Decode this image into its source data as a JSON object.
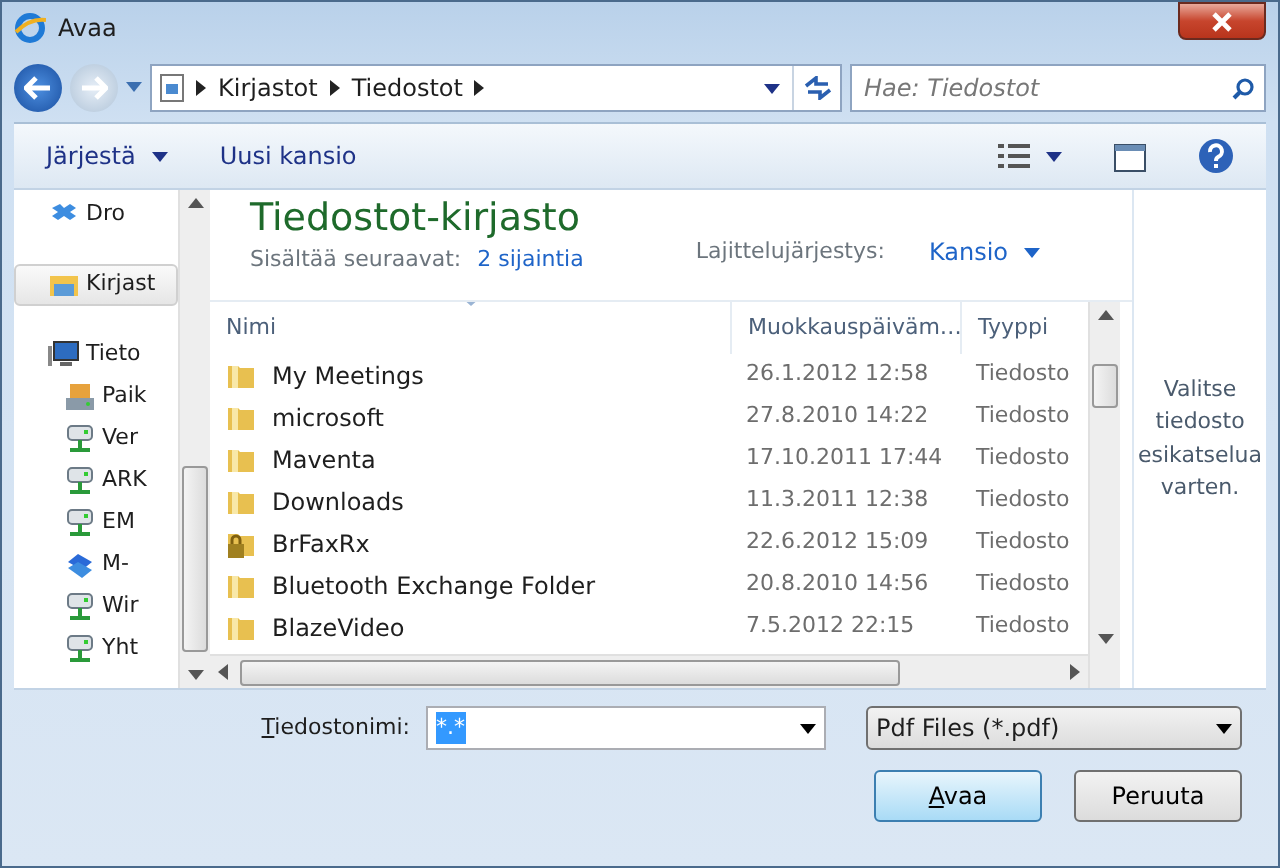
{
  "window": {
    "title": "Avaa"
  },
  "address_bar": {
    "breadcrumbs": [
      "Kirjastot",
      "Tiedostot"
    ]
  },
  "search": {
    "placeholder": "Hae: Tiedostot"
  },
  "toolbar": {
    "buttons": [
      "Järjestä",
      "Uusi kansio"
    ]
  },
  "sidebar": {
    "items": [
      {
        "label": "Dro",
        "kind": "cloud",
        "selected": false
      },
      {
        "label": "Kirjast",
        "kind": "library",
        "selected": true
      },
      {
        "label": "Tieto",
        "kind": "computer",
        "selected": false,
        "children": [
          {
            "label": "Paik",
            "kind": "drive",
            "selected": false
          },
          {
            "label": "Ver",
            "kind": "network",
            "selected": false
          },
          {
            "label": "ARK",
            "kind": "network",
            "selected": false
          },
          {
            "label": "EM",
            "kind": "network",
            "selected": false
          },
          {
            "label": "M-",
            "kind": "share",
            "selected": false
          },
          {
            "label": "Wir",
            "kind": "network",
            "selected": false
          },
          {
            "label": "Yht",
            "kind": "network",
            "selected": false
          }
        ]
      }
    ]
  },
  "library": {
    "title": "Tiedostot-kirjasto",
    "subtitle": "Sisältää seuraavat:",
    "locations_link": "2 sijaintia",
    "sort_label": "Lajittelujärjestys:",
    "sort_value": "Kansio"
  },
  "table": {
    "columns": [
      "Nimi",
      "Muokkauspäiväm…",
      "Tyyppi"
    ],
    "rows": [
      {
        "kind": "folder",
        "name": "My Meetings",
        "modified": "26.1.2012 12:58",
        "type": "Tiedosto"
      },
      {
        "kind": "folder",
        "name": "microsoft",
        "modified": "27.8.2010 14:22",
        "type": "Tiedosto"
      },
      {
        "kind": "folder",
        "name": "Maventa",
        "modified": "17.10.2011 17:44",
        "type": "Tiedosto"
      },
      {
        "kind": "folder",
        "name": "Downloads",
        "modified": "11.3.2011 12:38",
        "type": "Tiedosto"
      },
      {
        "kind": "locked-folder",
        "name": "BrFaxRx",
        "modified": "22.6.2012 15:09",
        "type": "Tiedosto"
      },
      {
        "kind": "folder",
        "name": "Bluetooth Exchange Folder",
        "modified": "20.8.2010 14:56",
        "type": "Tiedosto"
      },
      {
        "kind": "folder",
        "name": "BlazeVideo",
        "modified": "7.5.2012 22:15",
        "type": "Tiedosto"
      }
    ]
  },
  "preview": {
    "message": "Valitse tiedosto esikatselua varten."
  },
  "file_name": {
    "label": "Tiedostonimi:",
    "value": "*.*",
    "value_selected": true
  },
  "file_type": {
    "value": "Pdf Files (*.pdf)"
  },
  "buttons": [
    {
      "label": "Avaa",
      "default": true
    },
    {
      "label": "Peruuta",
      "default": false
    }
  ]
}
